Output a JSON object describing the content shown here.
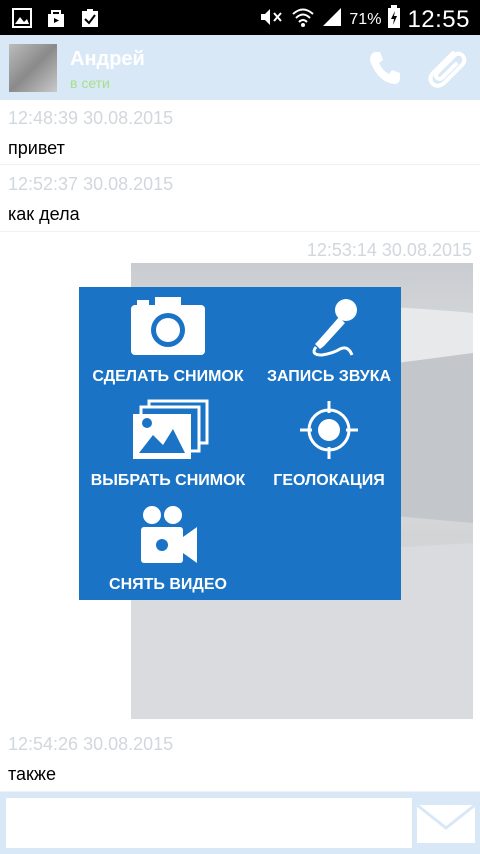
{
  "status_bar": {
    "battery": "71%",
    "time": "12:55"
  },
  "header": {
    "contact_name": "Андрей",
    "contact_status": "в сети"
  },
  "messages": [
    {
      "timestamp": "12:48:39 30.08.2015",
      "text": "привет",
      "align": "left"
    },
    {
      "timestamp": "12:52:37 30.08.2015",
      "text": "как дела",
      "align": "left"
    },
    {
      "timestamp": "12:53:14 30.08.2015",
      "text": "",
      "align": "right"
    },
    {
      "timestamp": "12:54:26 30.08.2015",
      "text": "также",
      "align": "left"
    }
  ],
  "attach_menu": {
    "take_photo": "СДЕЛАТЬ СНИМОК",
    "record_audio": "ЗАПИСЬ ЗВУКА",
    "choose_photo": "ВЫБРАТЬ СНИМОК",
    "geolocation": "ГЕОЛОКАЦИЯ",
    "record_video": "СНЯТЬ ВИДЕО"
  },
  "composer": {
    "placeholder": ""
  },
  "colors": {
    "header_bg": "#d8e8f6",
    "menu_bg": "#1a73c4",
    "timestamp": "#d2d7dd",
    "online": "#a7e08a"
  }
}
